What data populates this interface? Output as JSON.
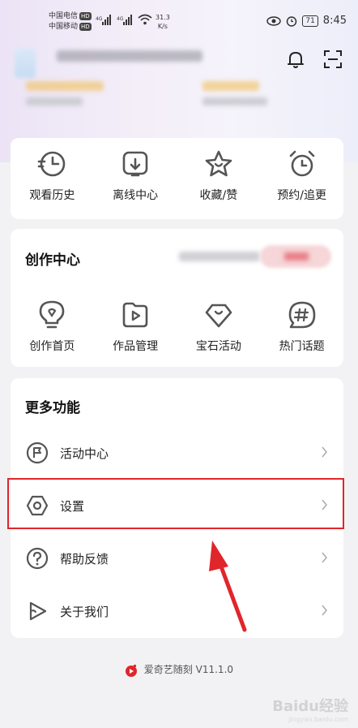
{
  "status_bar": {
    "carrier_1": "中国电信",
    "carrier_2": "中国移动",
    "hd_badge": "HD",
    "net_1": "4G",
    "net_2": "4G",
    "speed_value": "31.3",
    "speed_unit": "K/s",
    "battery": "71",
    "time": "8:45"
  },
  "quick_actions": [
    {
      "label": "观看历史",
      "icon": "history-icon"
    },
    {
      "label": "离线中心",
      "icon": "download-icon"
    },
    {
      "label": "收藏/赞",
      "icon": "star-icon"
    },
    {
      "label": "预约/追更",
      "icon": "alarm-clock-icon"
    }
  ],
  "creation_center": {
    "title": "创作中心",
    "items": [
      {
        "label": "创作首页",
        "icon": "lightbulb-icon"
      },
      {
        "label": "作品管理",
        "icon": "video-folder-icon"
      },
      {
        "label": "宝石活动",
        "icon": "gem-icon"
      },
      {
        "label": "热门话题",
        "icon": "hashtag-icon"
      }
    ]
  },
  "more_features": {
    "title": "更多功能",
    "items": [
      {
        "label": "活动中心",
        "icon": "flag-icon"
      },
      {
        "label": "设置",
        "icon": "hexagon-settings-icon"
      },
      {
        "label": "帮助反馈",
        "icon": "question-icon"
      },
      {
        "label": "关于我们",
        "icon": "play-icon"
      }
    ]
  },
  "footer": {
    "app_name": "爱奇艺随刻",
    "version": "V11.1.0"
  },
  "watermark": {
    "text": "Baidu经验",
    "url": "jingyan.baidu.com"
  },
  "colors": {
    "accent_red": "#e0262b",
    "icon_gray": "#555555"
  }
}
